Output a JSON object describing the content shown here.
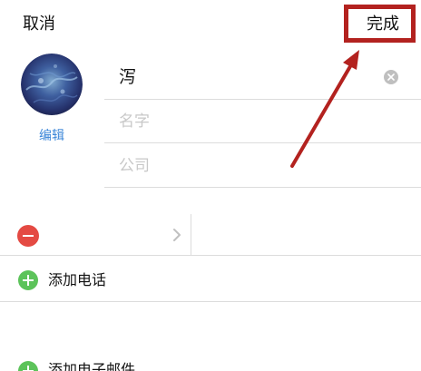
{
  "header": {
    "cancel_label": "取消",
    "done_label": "完成"
  },
  "contact": {
    "edit_avatar_label": "编辑",
    "name_value": "泻",
    "first_name_placeholder": "名字",
    "company_placeholder": "公司"
  },
  "phone": {
    "add_phone_label": "添加电话"
  },
  "email": {
    "add_email_label": "添加电子邮件"
  },
  "icons": {
    "clear": "clear-icon",
    "remove": "minus-circle-icon",
    "chevron": "chevron-right-icon",
    "add": "plus-circle-icon"
  },
  "colors": {
    "accent": "#3b86d8",
    "annotation": "#b3221f",
    "remove": "#e44a43",
    "add": "#5cc35a",
    "placeholder": "#c8c8c8",
    "separator": "#dcdcdc"
  }
}
